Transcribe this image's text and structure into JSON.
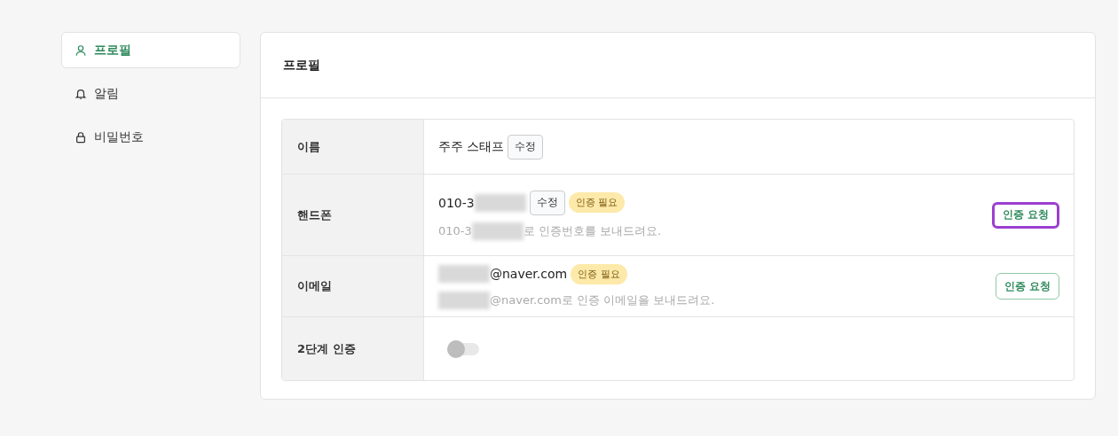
{
  "sidebar": {
    "items": [
      {
        "kind": "user",
        "label": "프로필",
        "selected": true
      },
      {
        "kind": "bell",
        "label": "알림",
        "selected": false
      },
      {
        "kind": "lock",
        "label": "비밀번호",
        "selected": false
      }
    ]
  },
  "panel": {
    "title": "프로필",
    "rows": [
      {
        "kind": "name",
        "label": "이름",
        "value": "주주 스태프",
        "edit_button": "수정"
      },
      {
        "kind": "verify",
        "label": "핸드폰",
        "value_prefix": "010-3",
        "masked": true,
        "value_suffix": "",
        "edit_button": "수정",
        "badge": "인증 필요",
        "hint_prefix": "010-3",
        "hint_suffix": "로 인증번호를 보내드려요.",
        "action": {
          "label": "인증 요청",
          "focused": true
        }
      },
      {
        "kind": "verify",
        "label": "이메일",
        "value_prefix": "",
        "masked": true,
        "value_suffix": "@naver.com",
        "badge": "인증 필요",
        "hint_prefix": "",
        "hint_suffix": "@naver.com로 인증 이메일을 보내드려요.",
        "action": {
          "label": "인증 요청",
          "focused": false
        }
      },
      {
        "kind": "toggle",
        "label": "2단계 인증",
        "on": false
      }
    ]
  }
}
